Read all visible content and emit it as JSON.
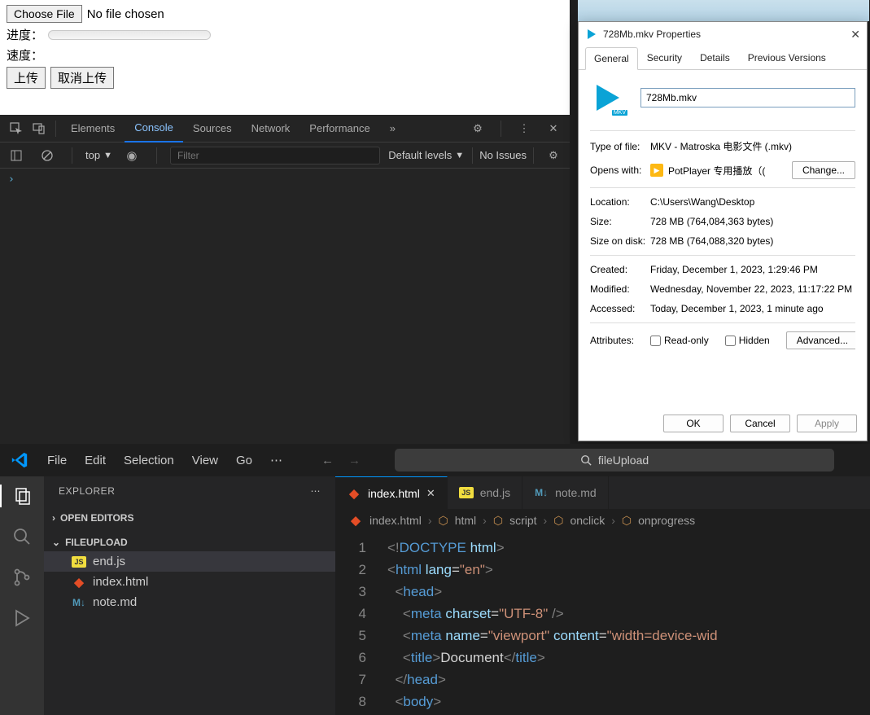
{
  "page": {
    "choose_file": "Choose File",
    "no_file": "No file chosen",
    "progress_label": "进度：",
    "speed_label": "速度：",
    "upload": "上传",
    "cancel": "取消上传"
  },
  "devtools": {
    "tabs": [
      "Elements",
      "Console",
      "Sources",
      "Network",
      "Performance"
    ],
    "active_tab": "Console",
    "more": "»",
    "context": "top",
    "filter_placeholder": "Filter",
    "levels": "Default levels",
    "issues": "No Issues",
    "prompt": "›"
  },
  "props": {
    "title": "728Mb.mkv Properties",
    "tabs": [
      "General",
      "Security",
      "Details",
      "Previous Versions"
    ],
    "active_tab": "General",
    "filename": "728Mb.mkv",
    "rows": {
      "type_label": "Type of file:",
      "type_val": "MKV - Matroska 电影文件 (.mkv)",
      "opens_label": "Opens with:",
      "opens_val": "PotPlayer 专用播放（(",
      "change": "Change...",
      "loc_label": "Location:",
      "loc_val": "C:\\Users\\Wang\\Desktop",
      "size_label": "Size:",
      "size_val": "728 MB (764,084,363 bytes)",
      "disk_label": "Size on disk:",
      "disk_val": "728 MB (764,088,320 bytes)",
      "created_label": "Created:",
      "created_val": "Friday, December 1, 2023, 1:29:46 PM",
      "mod_label": "Modified:",
      "mod_val": "Wednesday, November 22, 2023, 11:17:22 PM",
      "acc_label": "Accessed:",
      "acc_val": "Today, December 1, 2023, 1 minute ago",
      "attr_label": "Attributes:",
      "readonly": "Read-only",
      "hidden": "Hidden",
      "advanced": "Advanced..."
    },
    "buttons": {
      "ok": "OK",
      "cancel": "Cancel",
      "apply": "Apply"
    }
  },
  "vscode": {
    "menu": [
      "File",
      "Edit",
      "Selection",
      "View",
      "Go"
    ],
    "search": "fileUpload",
    "explorer_title": "EXPLORER",
    "sections": {
      "open_editors": "OPEN EDITORS",
      "folder": "FILEUPLOAD"
    },
    "files": [
      {
        "icon": "js",
        "name": "end.js"
      },
      {
        "icon": "html",
        "name": "index.html"
      },
      {
        "icon": "md",
        "name": "note.md"
      }
    ],
    "tabs": [
      {
        "icon": "html",
        "name": "index.html",
        "active": true
      },
      {
        "icon": "js",
        "name": "end.js",
        "active": false
      },
      {
        "icon": "md",
        "name": "note.md",
        "active": false
      }
    ],
    "breadcrumb": [
      "index.html",
      "html",
      "script",
      "onclick",
      "onprogress"
    ],
    "code_lines": [
      "<!DOCTYPE html>",
      "<html lang=\"en\">",
      "  <head>",
      "    <meta charset=\"UTF-8\" />",
      "    <meta name=\"viewport\" content=\"width=device-wid",
      "    <title>Document</title>",
      "  </head>",
      "  <body>"
    ]
  }
}
